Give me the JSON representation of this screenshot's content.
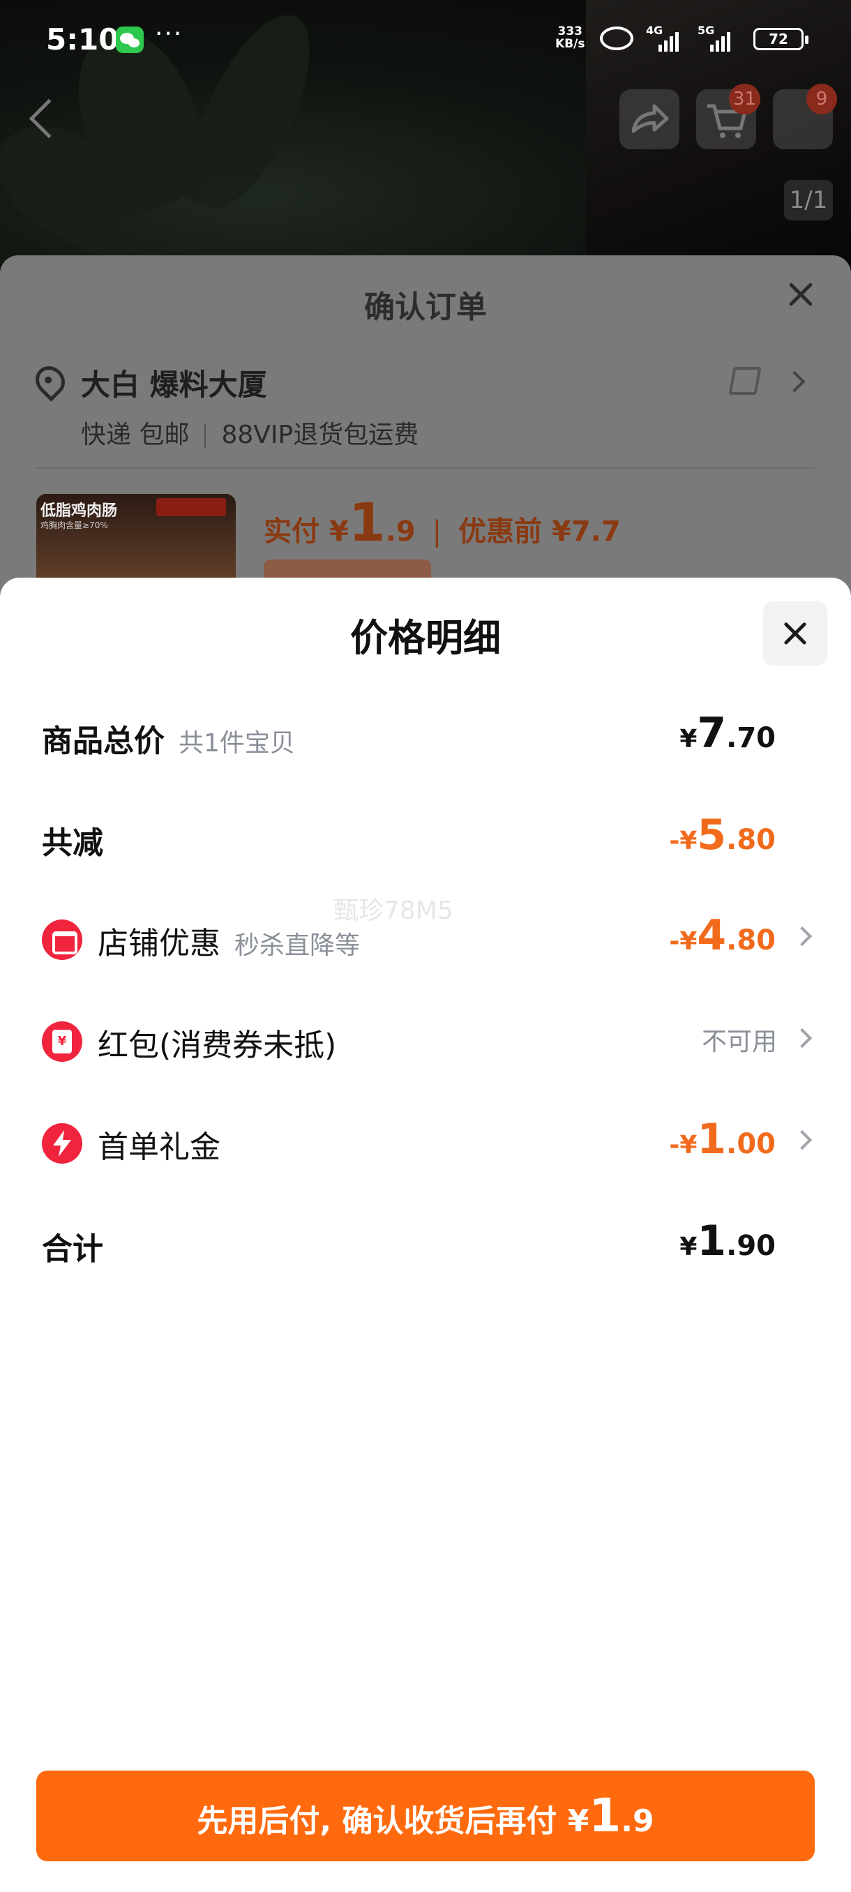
{
  "status_bar": {
    "time": "5:10",
    "more": "···",
    "net_speed_value": "333",
    "net_speed_unit": "KB/s",
    "signal_1": "4G",
    "signal_2": "5G",
    "battery": "72"
  },
  "top_nav": {
    "cart_count": "31",
    "more_count": "9",
    "image_counter": "1/1"
  },
  "order": {
    "title": "确认订单",
    "address_name": "大白 爆料大厦",
    "delivery": "快递 包邮",
    "return_note": "88VIP退货包运费",
    "product_thumb_title": "低脂鸡肉肠",
    "product_thumb_tag": "鸡胸肉含量≥70%",
    "paid_label": "实付",
    "paid_symbol": "¥",
    "paid_int": "1",
    "paid_dec": ".9",
    "separator": "|",
    "before_discount": "优惠前 ¥7.7"
  },
  "price_detail": {
    "title": "价格明细",
    "rows": [
      {
        "label": "商品总价",
        "sub": "共1件宝贝",
        "sym": "¥",
        "int": "7",
        "dec": ".70"
      },
      {
        "label": "共减",
        "sym": "-¥",
        "int": "5",
        "dec": ".80"
      },
      {
        "label": "店铺优惠",
        "sub": "秒杀直降等",
        "sym": "-¥",
        "int": "4",
        "dec": ".80",
        "icon": "shop-icon"
      },
      {
        "label": "红包(消费券未抵)",
        "value_text": "不可用",
        "icon": "red-envelope-icon"
      },
      {
        "label": "首单礼金",
        "sym": "-¥",
        "int": "1",
        "dec": ".00",
        "icon": "lightning-icon"
      },
      {
        "label": "合计",
        "sym": "¥",
        "int": "1",
        "dec": ".90"
      }
    ],
    "watermark": "甄珍78M5"
  },
  "pay_button": {
    "text": "先用后付, 确认收货后再付 ¥",
    "int": "1",
    "dec": ".9"
  },
  "colors": {
    "accent": "#ff6a0e",
    "discount": "#f26b1d",
    "icon_red": "#f0243d"
  }
}
